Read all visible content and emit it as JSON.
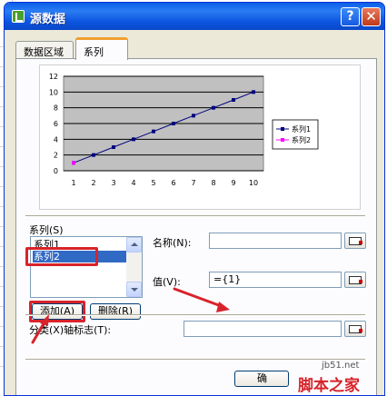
{
  "dialog": {
    "title": "源数据",
    "help_glyph": "?",
    "close_glyph": "✕"
  },
  "tabs": [
    {
      "label": "数据区域",
      "active": false
    },
    {
      "label": "系列",
      "active": true
    }
  ],
  "chart_data": {
    "type": "line",
    "x": [
      1,
      2,
      3,
      4,
      5,
      6,
      7,
      8,
      9,
      10
    ],
    "series": [
      {
        "name": "系列1",
        "values": [
          1,
          2,
          3,
          4,
          5,
          6,
          7,
          8,
          9,
          10
        ],
        "color": "#000080"
      },
      {
        "name": "系列2",
        "values": [
          1
        ],
        "color": "#ff00ff"
      }
    ],
    "xticks": [
      "1",
      "2",
      "3",
      "4",
      "5",
      "6",
      "7",
      "8",
      "9",
      "10"
    ],
    "yticks": [
      "0",
      "2",
      "4",
      "6",
      "8",
      "10",
      "12"
    ],
    "ylim": [
      0,
      12
    ],
    "grid": true,
    "plot_background": "#c0c0c0",
    "legend": "right"
  },
  "series_section": {
    "label": "系列(S)",
    "items": [
      {
        "label": "系列1",
        "selected": false
      },
      {
        "label": "系列2",
        "selected": true
      }
    ],
    "add_label": "添加(A)",
    "delete_label": "删除(R)"
  },
  "fields": {
    "name_label": "名称(N):",
    "name_value": "",
    "value_label": "值(V):",
    "value_value": "={1}",
    "category_label": "分类(X)轴标志(T):",
    "category_value": ""
  },
  "footer": {
    "ok_partial": "确"
  },
  "watermark": {
    "site": "jb51.net",
    "brand": "脚本之家"
  },
  "colors": {
    "title_bar": "#0a5fe8",
    "highlight": "#d8232a",
    "selection": "#316ac5"
  }
}
